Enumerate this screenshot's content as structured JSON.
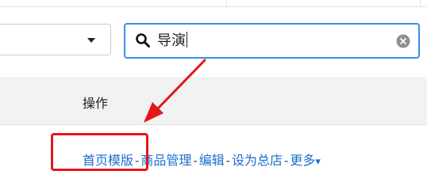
{
  "filter": {
    "selected": "",
    "caret_icon": "triangle-down-icon"
  },
  "search": {
    "value": "导演",
    "icon": "search-icon",
    "clear_icon": "clear-circle-icon",
    "border_color": "#3d8ee8"
  },
  "table": {
    "column_header": "操作",
    "row_actions": {
      "homepage_template": "首页模版",
      "product_management": "商品管理",
      "edit": "编辑",
      "set_as_head_store": "设为总店",
      "more": "更多",
      "separator": "-",
      "more_caret": "▾"
    }
  },
  "annotation": {
    "highlight_color": "#e3161c",
    "highlight_target": "homepage_template"
  },
  "colors": {
    "link": "#1a6fd1",
    "header_band": "#f2f2f2"
  }
}
